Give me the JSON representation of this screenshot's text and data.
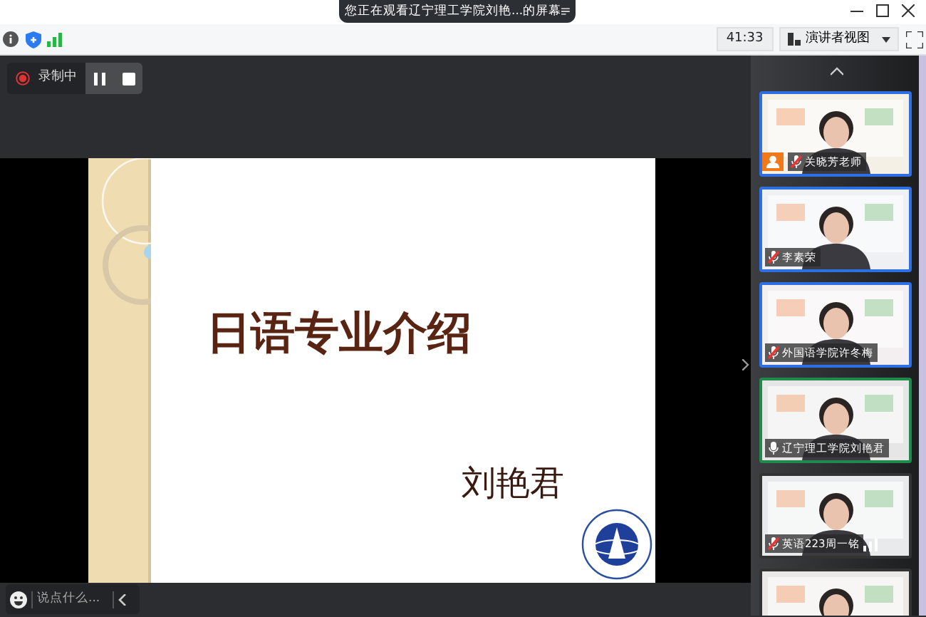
{
  "window": {
    "banner": "您正在观看辽宁理工学院刘艳...的屏幕"
  },
  "toolbar": {
    "timer": "41:33",
    "view_button": "演讲者视图"
  },
  "recording": {
    "label": "录制中"
  },
  "slide": {
    "title": "日语专业介绍",
    "author": "刘艳君"
  },
  "chat": {
    "placeholder": "说点什么..."
  },
  "participants": [
    {
      "kind": "video",
      "name": "关晓芳老师",
      "muted": true,
      "host": true,
      "color": "#2f6fe4"
    },
    {
      "kind": "video",
      "name": "李素荣",
      "muted": true,
      "color": "#2f6fe4"
    },
    {
      "kind": "video",
      "name": "外国语学院许冬梅",
      "muted": true,
      "color": "#2f6fe4"
    },
    {
      "kind": "video",
      "name": "辽宁理工学院刘艳君",
      "muted": false,
      "color": "#1f8a4c"
    },
    {
      "kind": "video",
      "name": "英语223周一铭",
      "muted": true,
      "show_signal": true
    },
    {
      "kind": "video"
    }
  ]
}
